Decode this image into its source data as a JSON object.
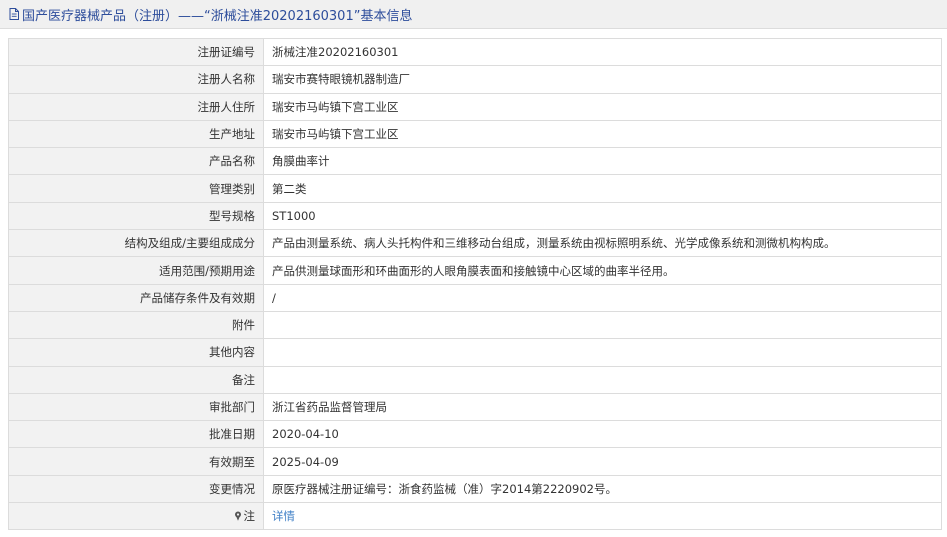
{
  "header": {
    "title": "国产医疗器械产品（注册）——“浙械注准20202160301”基本信息",
    "icon": "document-icon"
  },
  "rows": [
    {
      "label": "注册证编号",
      "value": "浙械注准20202160301"
    },
    {
      "label": "注册人名称",
      "value": "瑞安市赛特眼镜机器制造厂"
    },
    {
      "label": "注册人住所",
      "value": "瑞安市马屿镇下宫工业区"
    },
    {
      "label": "生产地址",
      "value": "瑞安市马屿镇下宫工业区"
    },
    {
      "label": "产品名称",
      "value": "角膜曲率计"
    },
    {
      "label": "管理类别",
      "value": "第二类"
    },
    {
      "label": "型号规格",
      "value": "ST1000"
    },
    {
      "label": "结构及组成/主要组成成分",
      "value": "产品由测量系统、病人头托构件和三维移动台组成，测量系统由视标照明系统、光学成像系统和测微机构构成。"
    },
    {
      "label": "适用范围/预期用途",
      "value": "产品供测量球面形和环曲面形的人眼角膜表面和接触镜中心区域的曲率半径用。"
    },
    {
      "label": "产品储存条件及有效期",
      "value": "/"
    },
    {
      "label": "附件",
      "value": ""
    },
    {
      "label": "其他内容",
      "value": ""
    },
    {
      "label": "备注",
      "value": ""
    },
    {
      "label": "审批部门",
      "value": "浙江省药品监督管理局"
    },
    {
      "label": "批准日期",
      "value": "2020-04-10"
    },
    {
      "label": "有效期至",
      "value": "2025-04-09"
    },
    {
      "label": "变更情况",
      "value": "原医疗器械注册证编号：浙食药监械（准）字2014第2220902号。"
    }
  ],
  "note_row": {
    "label": "注",
    "icon": "pin-icon",
    "link": "详情"
  },
  "colors": {
    "title": "#2d4d9b",
    "label_bg": "#f2f2f2",
    "border": "#dcdcdc",
    "link": "#3f7fc6"
  }
}
